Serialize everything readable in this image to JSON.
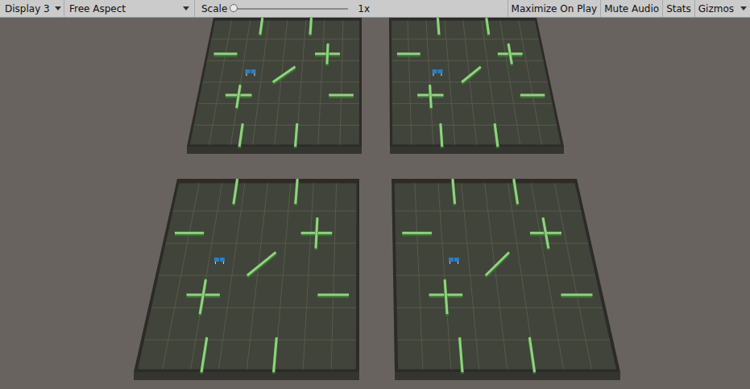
{
  "toolbar": {
    "display": {
      "label": "Display 3"
    },
    "aspect": {
      "label": "Free Aspect"
    },
    "scale": {
      "label": "Scale",
      "level": 0,
      "reading": "1x"
    },
    "toggles": [
      {
        "label": "Maximize On Play",
        "on": false,
        "dropdown": false
      },
      {
        "label": "Mute Audio",
        "on": false,
        "dropdown": false
      },
      {
        "label": "Stats",
        "on": false,
        "dropdown": false
      },
      {
        "label": "Gizmos",
        "on": false,
        "dropdown": true
      }
    ]
  }
}
